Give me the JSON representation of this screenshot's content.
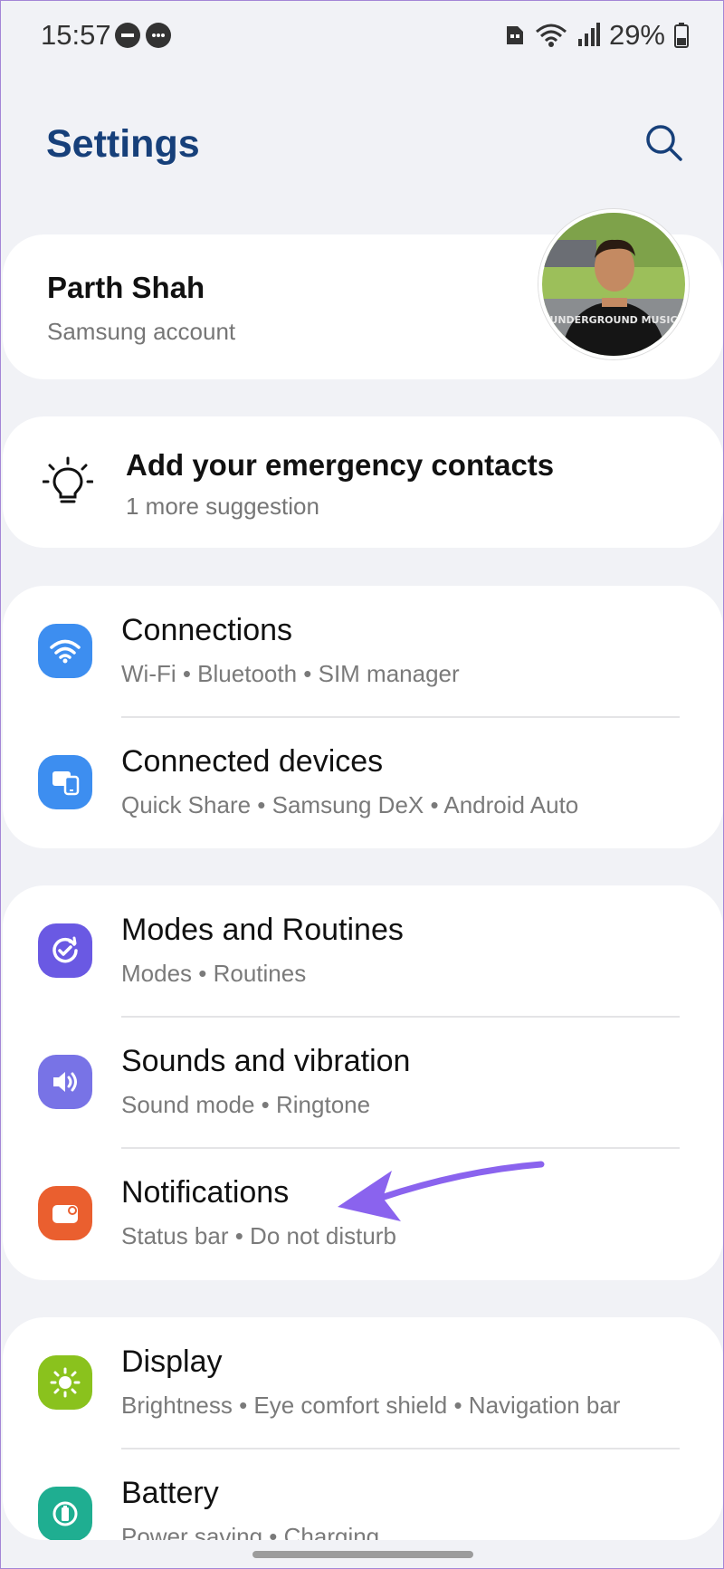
{
  "status_bar": {
    "time": "15:57",
    "battery": "29%"
  },
  "header": {
    "title": "Settings",
    "search_icon": "search-icon"
  },
  "account": {
    "name": "Parth Shah",
    "subtitle": "Samsung account",
    "avatar_shirt_text": "UNDERGROUND MUSIC"
  },
  "suggestion": {
    "title": "Add your emergency contacts",
    "subtitle": "1 more suggestion",
    "icon": "lightbulb-icon"
  },
  "groups": [
    {
      "items": [
        {
          "title": "Connections",
          "subtitle": "Wi-Fi  •  Bluetooth  •  SIM manager",
          "icon": "wifi-icon",
          "color": "#3d8ef0"
        },
        {
          "title": "Connected devices",
          "subtitle": "Quick Share  •  Samsung DeX  •  Android Auto",
          "icon": "devices-icon",
          "color": "#3d8ef0"
        }
      ]
    },
    {
      "items": [
        {
          "title": "Modes and Routines",
          "subtitle": "Modes  •  Routines",
          "icon": "modes-icon",
          "color": "#6a59e3"
        },
        {
          "title": "Sounds and vibration",
          "subtitle": "Sound mode  •  Ringtone",
          "icon": "sound-icon",
          "color": "#7873e6"
        },
        {
          "title": "Notifications",
          "subtitle": "Status bar  •  Do not disturb",
          "icon": "notifications-icon",
          "color": "#ea5f2f"
        }
      ]
    },
    {
      "items": [
        {
          "title": "Display",
          "subtitle": "Brightness  •  Eye comfort shield  •  Navigation bar",
          "icon": "display-icon",
          "color": "#8ac21d"
        },
        {
          "title": "Battery",
          "subtitle": "Power saving  •  Charging",
          "icon": "battery-icon",
          "color": "#1fae91"
        }
      ]
    }
  ],
  "colors": {
    "title": "#17407a",
    "annotation_arrow": "#8a63ee",
    "background": "#f1f2f6"
  }
}
